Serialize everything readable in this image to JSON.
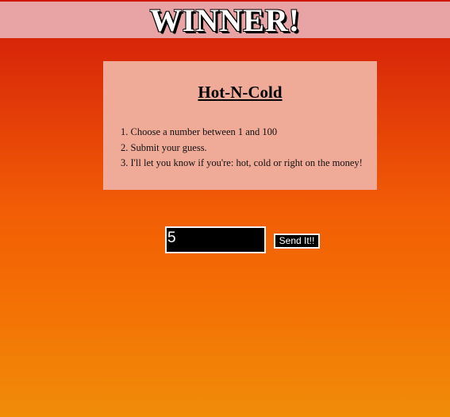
{
  "banner": {
    "title": "WINNER!"
  },
  "card": {
    "title": "Hot-N-Cold",
    "steps": [
      "1. Choose a number between 1 and 100",
      "2. Submit your guess.",
      "3. I'll let you know if you're: hot, cold or right on the money!"
    ]
  },
  "form": {
    "guess_value": "5",
    "submit_label": "Send It!!"
  },
  "colors": {
    "banner_bg": "#e8a4a4",
    "card_bg": "#f0aa98",
    "gradient_top": "#d0180a",
    "gradient_bottom": "#f08c08",
    "input_bg": "#000000"
  }
}
